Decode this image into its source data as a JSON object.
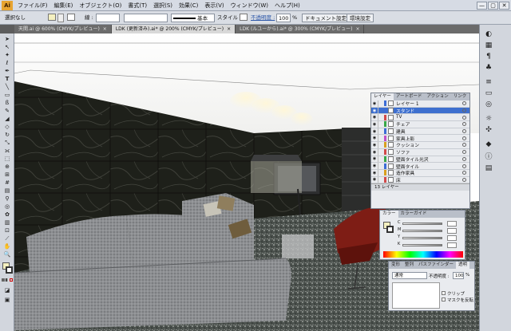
{
  "app": {
    "logo": "Ai"
  },
  "menubar": {
    "items": [
      "ファイル(F)",
      "編集(E)",
      "オブジェクト(O)",
      "書式(T)",
      "選択(S)",
      "効果(C)",
      "表示(V)",
      "ウィンドウ(W)",
      "ヘルプ(H)"
    ],
    "window_buttons": [
      "—",
      "▢",
      "✕"
    ]
  },
  "controlbar": {
    "selection_label": "選択なし",
    "stroke_label": "線 :",
    "brush_label": "基本",
    "style_label": "スタイル :",
    "opacity_label": "不透明度 :",
    "opacity_value": "100",
    "opacity_unit": "%",
    "doc_settings": "ドキュメント設定",
    "env_settings": "環境設定"
  },
  "tabs": [
    {
      "label": "天開.ai @ 600% (CMYK/プレビュー)",
      "close": "×",
      "active": false
    },
    {
      "label": "LDK (更新済み).ai* @ 200% (CMYK/プレビュー)",
      "close": "×",
      "active": true
    },
    {
      "label": "LDK (ルユーから).ai* @ 300% (CMYK/プレビュー)",
      "close": "×",
      "active": false
    }
  ],
  "layers_panel": {
    "tabs": [
      "レイヤー",
      "アートボード",
      "アクション",
      "リンク"
    ],
    "layers": [
      {
        "name": "レイヤー 1",
        "color": "#3c6cd6",
        "selected": false
      },
      {
        "name": "スタンド",
        "color": "#3c6cd6",
        "selected": true
      },
      {
        "name": "TV",
        "color": "#d24a4a",
        "selected": false
      },
      {
        "name": "チェア",
        "color": "#38a848",
        "selected": false
      },
      {
        "name": "建具",
        "color": "#3c6cd6",
        "selected": false
      },
      {
        "name": "家具上影",
        "color": "#c050c8",
        "selected": false
      },
      {
        "name": "クッション",
        "color": "#d8a020",
        "selected": false
      },
      {
        "name": "ソファ",
        "color": "#d24a4a",
        "selected": false
      },
      {
        "name": "壁面タイル光沢",
        "color": "#38a848",
        "selected": false
      },
      {
        "name": "壁面タイル",
        "color": "#3c6cd6",
        "selected": false
      },
      {
        "name": "造作家具",
        "color": "#d8a020",
        "selected": false
      },
      {
        "name": "床",
        "color": "#d24a4a",
        "selected": false
      }
    ],
    "footer": "13 レイヤー"
  },
  "color_panel": {
    "tabs": [
      "カラー",
      "カラーガイド"
    ],
    "channels": [
      "C",
      "M",
      "Y",
      "K"
    ]
  },
  "transparency_panel": {
    "tabs": [
      "変形",
      "整列",
      "パスファインダー",
      "透明"
    ],
    "blend_mode": "通常",
    "opacity_label": "不透明度 :",
    "opacity_value": "100",
    "opacity_unit": "%",
    "clip_label": "クリップ",
    "invert_label": "マスクを反転"
  },
  "colors": {
    "ui_bg": "#d2d6dd",
    "menu_bg": "#d6dbe4",
    "selection": "#3d6fcf",
    "marble": "#232521",
    "sofa": "#8a8c8f",
    "chair": "#8a1e16"
  },
  "icons": {
    "tools": [
      "selection-arrow",
      "direct-selection",
      "magic-wand",
      "lasso",
      "pen",
      "type",
      "line",
      "rectangle",
      "paintbrush",
      "pencil",
      "blob-brush",
      "eraser",
      "rotate",
      "scale",
      "width",
      "free-transform",
      "shape-builder",
      "perspective-grid",
      "mesh",
      "gradient",
      "eyedropper",
      "blend",
      "symbol-sprayer",
      "column-graph",
      "artboard",
      "slice",
      "hand",
      "zoom"
    ],
    "dock": [
      "color-icon",
      "swatches-icon",
      "brushes-icon",
      "symbols-icon",
      "stroke-icon",
      "gradient-icon",
      "appearance-icon",
      "graphic-styles-icon",
      "layers-icon",
      "info-icon",
      "align-icon"
    ]
  }
}
